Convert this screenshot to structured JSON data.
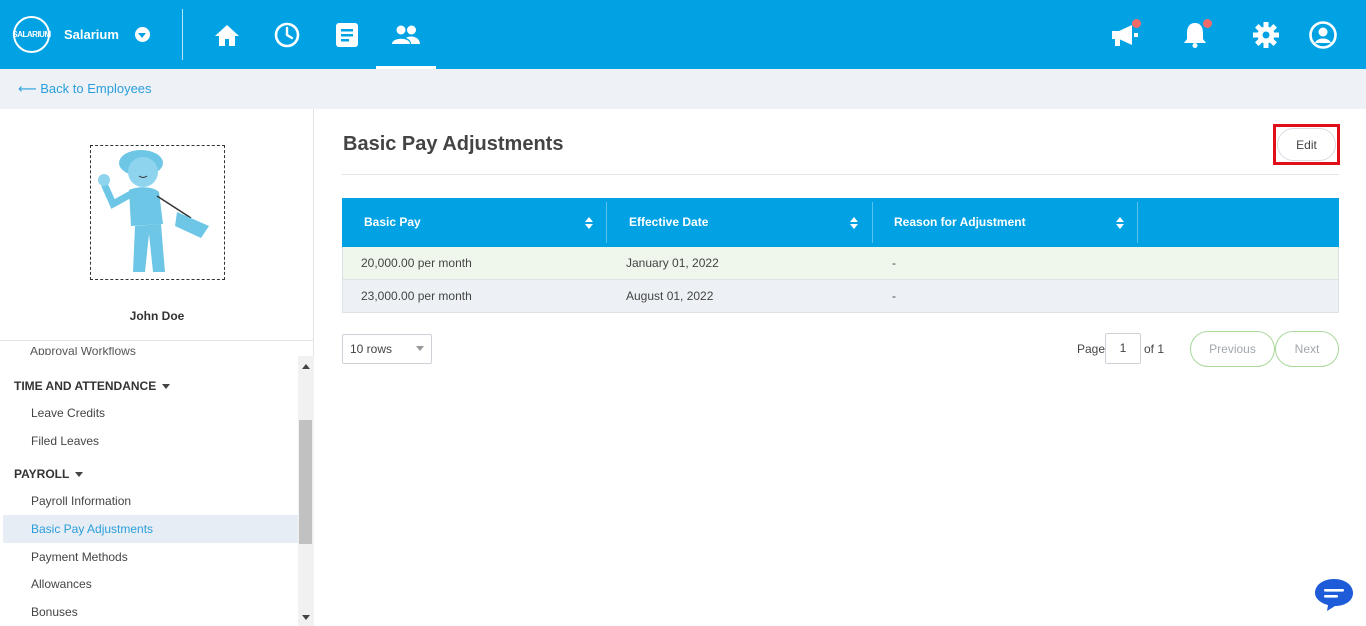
{
  "brand": {
    "logo_text": "SALARIUM",
    "name": "Salarium"
  },
  "colors": {
    "topbar": "#00a2e4",
    "link": "#2b9fdc",
    "highlight_outline": "#e0101a",
    "notification_dot": "#f26b6b"
  },
  "nav": {
    "items": [
      {
        "icon": "home-icon",
        "active": false
      },
      {
        "icon": "clock-icon",
        "active": false
      },
      {
        "icon": "document-icon",
        "active": false
      },
      {
        "icon": "people-icon",
        "active": true
      }
    ],
    "right_icons": [
      "megaphone-icon",
      "bell-icon",
      "gear-icon",
      "user-account-icon"
    ]
  },
  "back_link": "⟵ Back to Employees",
  "employee": {
    "name": "John Doe"
  },
  "sidebar": {
    "cut_item": "Approval Workflows",
    "sections": [
      {
        "heading": "TIME AND ATTENDANCE",
        "items": [
          "Leave Credits",
          "Filed Leaves"
        ]
      },
      {
        "heading": "PAYROLL",
        "items": [
          "Payroll Information",
          "Basic Pay Adjustments",
          "Payment Methods",
          "Allowances",
          "Bonuses"
        ]
      }
    ],
    "active_item": "Basic Pay Adjustments"
  },
  "main": {
    "title": "Basic Pay Adjustments",
    "edit_label": "Edit",
    "table": {
      "columns": [
        "Basic Pay",
        "Effective Date",
        "Reason for Adjustment"
      ],
      "rows": [
        [
          "20,000.00 per month",
          "January 01, 2022",
          "-"
        ],
        [
          "23,000.00 per month",
          "August 01, 2022",
          "-"
        ]
      ]
    },
    "pagination": {
      "rows_per_page": "10 rows",
      "page_label": "Page",
      "current_page": "1",
      "of_label": "of 1",
      "previous_label": "Previous",
      "next_label": "Next"
    }
  }
}
